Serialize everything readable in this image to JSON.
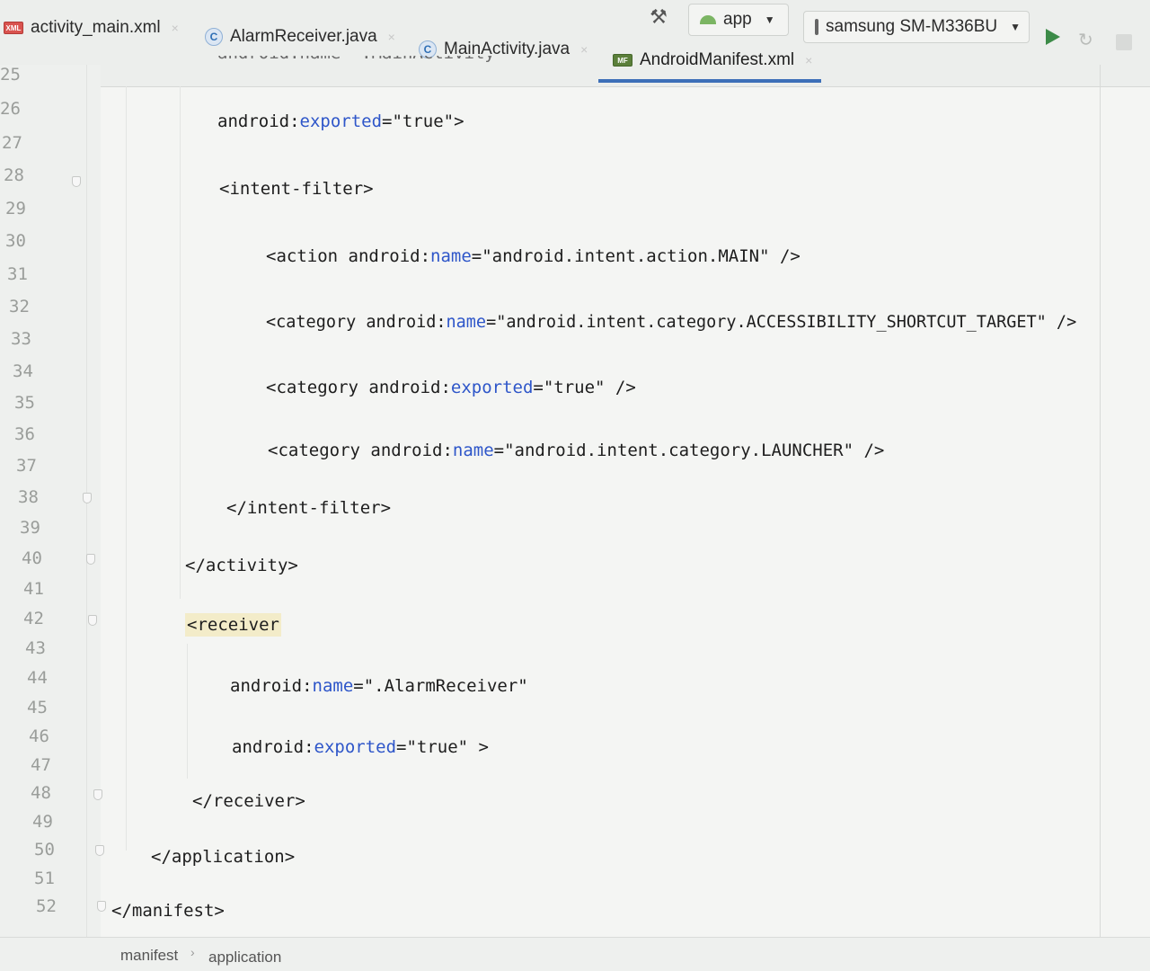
{
  "tabs": [
    {
      "label": "activity_main.xml",
      "icon": "xml-file-icon",
      "close": "×"
    },
    {
      "label": "AlarmReceiver.java",
      "icon": "java-class-icon",
      "close": "×"
    },
    {
      "label": "MainActivity.java",
      "icon": "java-class-icon",
      "close": "×"
    },
    {
      "label": "AndroidManifest.xml",
      "icon": "manifest-file-icon",
      "close": "×",
      "active": true
    }
  ],
  "tab_icon_text": {
    "class": "C",
    "xml": "XML",
    "manifest": "MF"
  },
  "toolbar": {
    "config": "app",
    "device": "samsung SM-M336BU",
    "caret": "▼",
    "hammer": "⚒",
    "rerun": "↻"
  },
  "editor": {
    "partial_top_line": "android:name=\".MainActivity\"",
    "line_numbers": [
      "25",
      "26",
      "27",
      "28",
      "29",
      "30",
      "31",
      "32",
      "33",
      "34",
      "35",
      "36",
      "37",
      "38",
      "39",
      "40",
      "41",
      "42",
      "43",
      "44",
      "45",
      "46",
      "47",
      "48",
      "49",
      "50",
      "51",
      "52"
    ],
    "lines": {
      "exported_activity": {
        "ns": "android:",
        "attr": "exported",
        "rest": "=\"true\">"
      },
      "intent_filter_open": "<intent-filter>",
      "action_main": {
        "tag": "<action ",
        "ns": "android:",
        "attr": "name",
        "rest": "=\"android.intent.action.MAIN\" />"
      },
      "category_accessibility": {
        "tag": "<category ",
        "ns": "android:",
        "attr": "name",
        "rest": "=\"android.intent.category.ACCESSIBILITY_SHORTCUT_TARGET\" />"
      },
      "category_exported": {
        "tag": "<category ",
        "ns": "android:",
        "attr": "exported",
        "rest": "=\"true\" />"
      },
      "category_launcher": {
        "tag": "<category ",
        "ns": "android:",
        "attr": "name",
        "rest": "=\"android.intent.category.LAUNCHER\" />"
      },
      "intent_filter_close": "</intent-filter>",
      "activity_close": "</activity>",
      "receiver_open": "<receiver",
      "receiver_name": {
        "ns": "android:",
        "attr": "name",
        "rest": "=\".AlarmReceiver\""
      },
      "receiver_exported": {
        "ns": "android:",
        "attr": "exported",
        "rest": "=\"true\" >"
      },
      "receiver_close": "</receiver>",
      "application_close": "</application>",
      "manifest_close": "</manifest>"
    }
  },
  "breadcrumb": {
    "items": [
      "manifest",
      "application"
    ],
    "separator": "›"
  },
  "colors": {
    "attribute": "#2e56c9",
    "active_tab_underline": "#3d6fb8",
    "highlight": "#f3ecc9",
    "run": "#3c8b48"
  }
}
